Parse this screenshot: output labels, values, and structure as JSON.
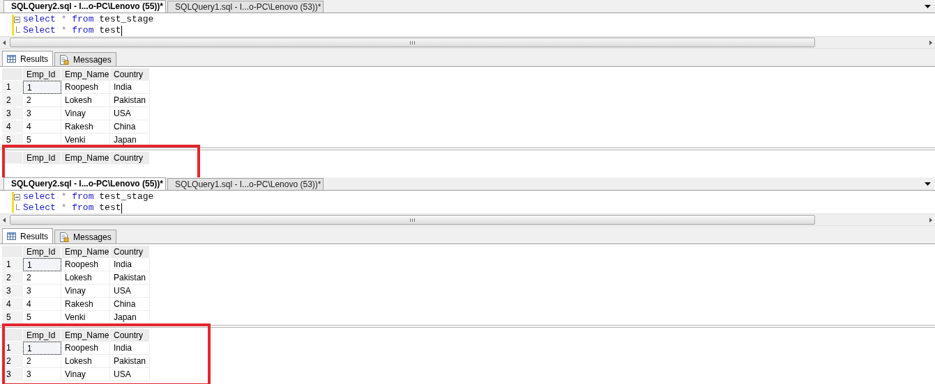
{
  "panels": [
    {
      "doc_tabs": [
        {
          "label": "SQLQuery2.sql - I...o-PC\\Lenovo (55))*",
          "selected": true
        },
        {
          "label": "SQLQuery1.sql - I...o-PC\\Lenovo (53))*",
          "selected": false
        }
      ],
      "editor": {
        "lines": [
          [
            {
              "kind": "keyword",
              "text": "select"
            },
            {
              "kind": "operator",
              "text": "*"
            },
            {
              "kind": "keyword",
              "text": "from"
            },
            {
              "kind": "name",
              "text": "test_stage"
            }
          ],
          [
            {
              "kind": "keyword",
              "text": "Select"
            },
            {
              "kind": "operator",
              "text": "*"
            },
            {
              "kind": "keyword",
              "text": "from"
            },
            {
              "kind": "name",
              "text": "test"
            }
          ]
        ]
      },
      "result_tabs": [
        {
          "label": "Results",
          "kind": "grid",
          "selected": true
        },
        {
          "label": "Messages",
          "kind": "messages",
          "selected": false
        }
      ],
      "result_sets": [
        {
          "highlighted": false,
          "columns": [
            "Emp_Id",
            "Emp_Name",
            "Country"
          ],
          "rows": [
            {
              "number": "1",
              "cells": [
                "1",
                "Roopesh",
                "India"
              ],
              "focused": true
            },
            {
              "number": "2",
              "cells": [
                "2",
                "Lokesh",
                "Pakistan"
              ],
              "focused": false
            },
            {
              "number": "3",
              "cells": [
                "3",
                "Vinay",
                "USA"
              ],
              "focused": false
            },
            {
              "number": "4",
              "cells": [
                "4",
                "Rakesh",
                "China"
              ],
              "focused": false
            },
            {
              "number": "5",
              "cells": [
                "5",
                "Venki",
                "Japan"
              ],
              "focused": false
            }
          ]
        },
        {
          "highlighted": true,
          "columns": [
            "Emp_Id",
            "Emp_Name",
            "Country"
          ]
        }
      ]
    },
    {
      "doc_tabs": [
        {
          "label": "SQLQuery2.sql - I...o-PC\\Lenovo (55))*",
          "selected": true
        },
        {
          "label": "SQLQuery1.sql - I...o-PC\\Lenovo (53))*",
          "selected": false
        }
      ],
      "editor": {
        "lines": [
          [
            {
              "kind": "keyword",
              "text": "select"
            },
            {
              "kind": "operator",
              "text": "*"
            },
            {
              "kind": "keyword",
              "text": "from"
            },
            {
              "kind": "name",
              "text": "test_stage"
            }
          ],
          [
            {
              "kind": "keyword",
              "text": "Select"
            },
            {
              "kind": "operator",
              "text": "*"
            },
            {
              "kind": "keyword",
              "text": "from"
            },
            {
              "kind": "name",
              "text": "test"
            }
          ]
        ]
      },
      "result_tabs": [
        {
          "label": "Results",
          "kind": "grid",
          "selected": true
        },
        {
          "label": "Messages",
          "kind": "messages",
          "selected": false
        }
      ],
      "result_sets": [
        {
          "highlighted": false,
          "columns": [
            "Emp_Id",
            "Emp_Name",
            "Country"
          ],
          "rows": [
            {
              "number": "1",
              "cells": [
                "1",
                "Roopesh",
                "India"
              ],
              "focused": true
            },
            {
              "number": "2",
              "cells": [
                "2",
                "Lokesh",
                "Pakistan"
              ],
              "focused": false
            },
            {
              "number": "3",
              "cells": [
                "3",
                "Vinay",
                "USA"
              ],
              "focused": false
            },
            {
              "number": "4",
              "cells": [
                "4",
                "Rakesh",
                "China"
              ],
              "focused": false
            },
            {
              "number": "5",
              "cells": [
                "5",
                "Venki",
                "Japan"
              ],
              "focused": false
            }
          ]
        },
        {
          "highlighted": true,
          "columns": [
            "Emp_Id",
            "Emp_Name",
            "Country"
          ],
          "rows": [
            {
              "number": "1",
              "cells": [
                "1",
                "Roopesh",
                "India"
              ],
              "focused": true
            },
            {
              "number": "2",
              "cells": [
                "2",
                "Lokesh",
                "Pakistan"
              ],
              "focused": false
            },
            {
              "number": "3",
              "cells": [
                "3",
                "Vinay",
                "USA"
              ],
              "focused": false
            }
          ]
        }
      ]
    }
  ]
}
